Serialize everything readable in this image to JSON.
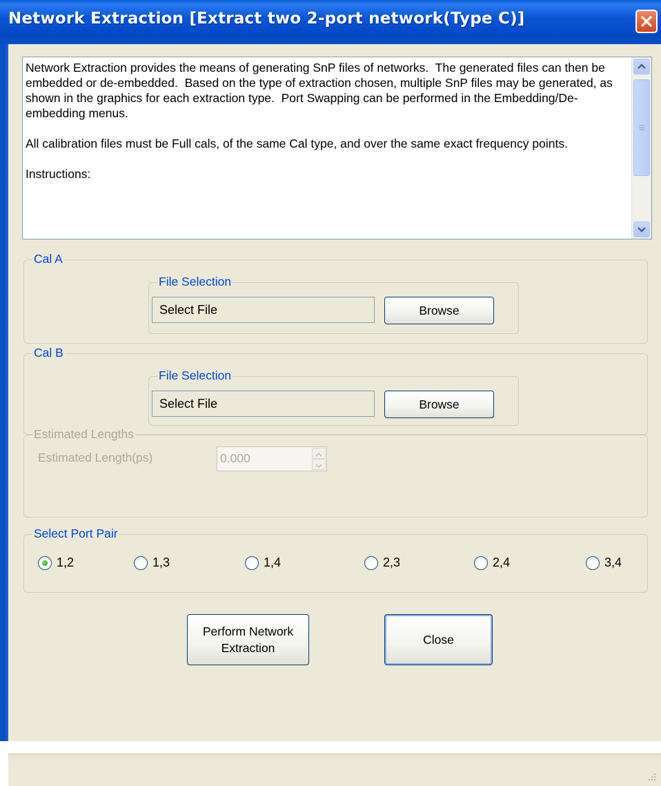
{
  "window": {
    "title": "Network Extraction [Extract two 2-port network(Type C)]"
  },
  "description": {
    "paragraphs": [
      "Network Extraction provides the means of generating SnP files of networks.  The generated files can then be embedded or de-embedded.  Based on the type of extraction chosen, multiple SnP files may be generated, as shown in the graphics for each extraction type.  Port Swapping can be performed in the Embedding/De-embedding menus.",
      "All calibration files must be Full cals, of the same Cal type, and over the same exact frequency points.",
      "Instructions:"
    ]
  },
  "cal_a": {
    "legend": "Cal A",
    "file_selection_legend": "File Selection",
    "file_value": "Select File",
    "browse_label": "Browse"
  },
  "cal_b": {
    "legend": "Cal B",
    "file_selection_legend": "File Selection",
    "file_value": "Select File",
    "browse_label": "Browse"
  },
  "estimated_lengths": {
    "legend": "Estimated Lengths",
    "label": "Estimated Length(ps)",
    "value": "0.000",
    "enabled": false
  },
  "port_pair": {
    "legend": "Select Port Pair",
    "options": [
      "1,2",
      "1,3",
      "1,4",
      "2,3",
      "2,4",
      "3,4"
    ],
    "selected": "1,2"
  },
  "actions": {
    "perform_line1": "Perform Network",
    "perform_line2": "Extraction",
    "close_label": "Close"
  },
  "colors": {
    "titlebar": "#0349c4",
    "group_legend": "#0046d5",
    "disabled_text": "#aca899",
    "dialog_bg": "#ece9d8",
    "radio_selected": "#21a121"
  },
  "icons": {
    "title_close": "close-icon",
    "scroll_up": "scroll-up-arrow-icon",
    "scroll_down": "scroll-down-arrow-icon",
    "resize_grip": "resize-grip-icon"
  }
}
